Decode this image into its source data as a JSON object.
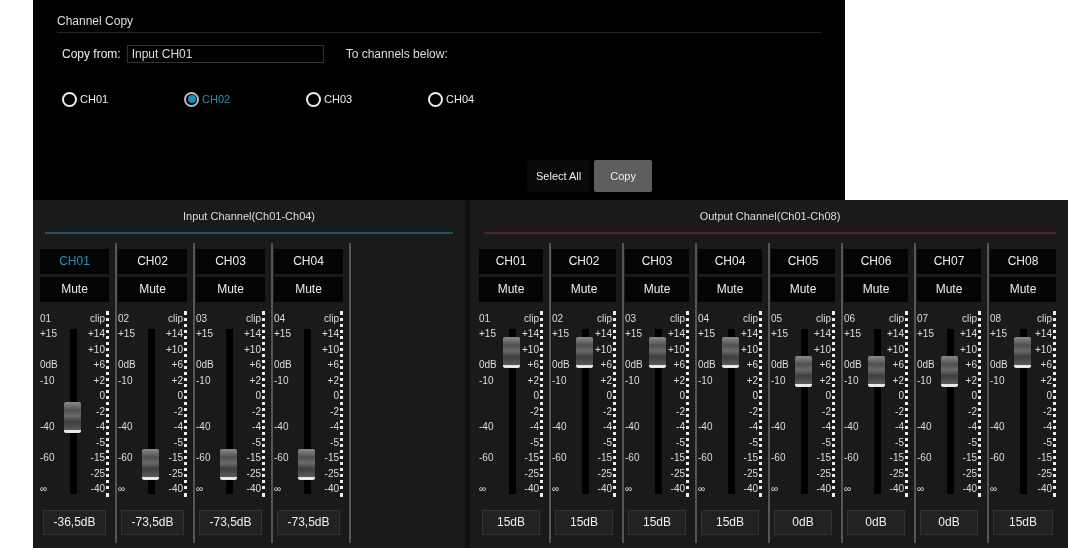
{
  "channel_copy": {
    "title": "Channel Copy",
    "copy_from_label": "Copy from:",
    "copy_from_value": "Input CH01",
    "to_label": "To channels below:",
    "targets": [
      {
        "label": "CH01",
        "selected": false
      },
      {
        "label": "CH02",
        "selected": true
      },
      {
        "label": "CH03",
        "selected": false
      },
      {
        "label": "CH04",
        "selected": false
      }
    ],
    "buttons": [
      {
        "label": "Select All",
        "kind": "plain"
      },
      {
        "label": "Copy",
        "kind": "filled"
      }
    ]
  },
  "input_panel": {
    "title": "Input Channel(Ch01-Ch04)",
    "strips": [
      {
        "name": "CH01",
        "selected": true,
        "mute": "Mute",
        "number": "01",
        "left_scale": [
          "+15",
          "0dB",
          "-10",
          "-40",
          "-60",
          "∞"
        ],
        "right_scale": [
          "clip",
          "+14",
          "+10",
          "+6",
          "+2",
          "0",
          "-2",
          "-4",
          "-5",
          "-15",
          "-25",
          "-40"
        ],
        "level": 0.44,
        "readout": "-36,5dB"
      },
      {
        "name": "CH02",
        "selected": false,
        "mute": "Mute",
        "number": "02",
        "left_scale": [
          "+15",
          "0dB",
          "-10",
          "-40",
          "-60",
          "∞"
        ],
        "right_scale": [
          "clip",
          "+14",
          "+10",
          "+6",
          "+2",
          "0",
          "-2",
          "-4",
          "-5",
          "-15",
          "-25",
          "-40"
        ],
        "level": 0.08,
        "readout": "-73,5dB"
      },
      {
        "name": "CH03",
        "selected": false,
        "mute": "Mute",
        "number": "03",
        "left_scale": [
          "+15",
          "0dB",
          "-10",
          "-40",
          "-60",
          "∞"
        ],
        "right_scale": [
          "clip",
          "+14",
          "+10",
          "+6",
          "+2",
          "0",
          "-2",
          "-4",
          "-5",
          "-15",
          "-25",
          "-40"
        ],
        "level": 0.08,
        "readout": "-73,5dB"
      },
      {
        "name": "CH04",
        "selected": false,
        "mute": "Mute",
        "number": "04",
        "left_scale": [
          "+15",
          "0dB",
          "-10",
          "-40",
          "-60",
          "∞"
        ],
        "right_scale": [
          "clip",
          "+14",
          "+10",
          "+6",
          "+2",
          "0",
          "-2",
          "-4",
          "-5",
          "-15",
          "-25",
          "-40"
        ],
        "level": 0.08,
        "readout": "-73,5dB"
      }
    ]
  },
  "output_panel": {
    "title": "Output Channel(Ch01-Ch08)",
    "strips": [
      {
        "name": "CH01",
        "selected": false,
        "mute": "Mute",
        "number": "01",
        "left_scale": [
          "+15",
          "0dB",
          "-10",
          "-40",
          "-60",
          "∞"
        ],
        "right_scale": [
          "clip",
          "+14",
          "+10",
          "+6",
          "+2",
          "0",
          "-2",
          "-4",
          "-5",
          "-15",
          "-25",
          "-40"
        ],
        "level": 0.94,
        "readout": "15dB"
      },
      {
        "name": "CH02",
        "selected": false,
        "mute": "Mute",
        "number": "02",
        "left_scale": [
          "+15",
          "0dB",
          "-10",
          "-40",
          "-60",
          "∞"
        ],
        "right_scale": [
          "clip",
          "+14",
          "+10",
          "+6",
          "+2",
          "0",
          "-2",
          "-4",
          "-5",
          "-15",
          "-25",
          "-40"
        ],
        "level": 0.94,
        "readout": "15dB"
      },
      {
        "name": "CH03",
        "selected": false,
        "mute": "Mute",
        "number": "03",
        "left_scale": [
          "+15",
          "0dB",
          "-10",
          "-40",
          "-60",
          "∞"
        ],
        "right_scale": [
          "clip",
          "+14",
          "+10",
          "+6",
          "+2",
          "0",
          "-2",
          "-4",
          "-5",
          "-15",
          "-25",
          "-40"
        ],
        "level": 0.94,
        "readout": "15dB"
      },
      {
        "name": "CH04",
        "selected": false,
        "mute": "Mute",
        "number": "04",
        "left_scale": [
          "+15",
          "0dB",
          "-10",
          "-40",
          "-60",
          "∞"
        ],
        "right_scale": [
          "clip",
          "+14",
          "+10",
          "+6",
          "+2",
          "0",
          "-2",
          "-4",
          "-5",
          "-15",
          "-25",
          "-40"
        ],
        "level": 0.94,
        "readout": "15dB"
      },
      {
        "name": "CH05",
        "selected": false,
        "mute": "Mute",
        "number": "05",
        "left_scale": [
          "+15",
          "0dB",
          "-10",
          "-40",
          "-60",
          "∞"
        ],
        "right_scale": [
          "clip",
          "+14",
          "+10",
          "+6",
          "+2",
          "0",
          "-2",
          "-4",
          "-5",
          "-15",
          "-25",
          "-40"
        ],
        "level": 0.79,
        "readout": "0dB"
      },
      {
        "name": "CH06",
        "selected": false,
        "mute": "Mute",
        "number": "06",
        "left_scale": [
          "+15",
          "0dB",
          "-10",
          "-40",
          "-60",
          "∞"
        ],
        "right_scale": [
          "clip",
          "+14",
          "+10",
          "+6",
          "+2",
          "0",
          "-2",
          "-4",
          "-5",
          "-15",
          "-25",
          "-40"
        ],
        "level": 0.79,
        "readout": "0dB"
      },
      {
        "name": "CH07",
        "selected": false,
        "mute": "Mute",
        "number": "07",
        "left_scale": [
          "+15",
          "0dB",
          "-10",
          "-40",
          "-60",
          "∞"
        ],
        "right_scale": [
          "clip",
          "+14",
          "+10",
          "+6",
          "+2",
          "0",
          "-2",
          "-4",
          "-5",
          "-15",
          "-25",
          "-40"
        ],
        "level": 0.79,
        "readout": "0dB"
      },
      {
        "name": "CH08",
        "selected": false,
        "mute": "Mute",
        "number": "08",
        "left_scale": [
          "+15",
          "0dB",
          "-10",
          "-40",
          "-60",
          "∞"
        ],
        "right_scale": [
          "clip",
          "+14",
          "+10",
          "+6",
          "+2",
          "0",
          "-2",
          "-4",
          "-5",
          "-15",
          "-25",
          "-40"
        ],
        "level": 0.94,
        "readout": "15dB"
      }
    ]
  }
}
